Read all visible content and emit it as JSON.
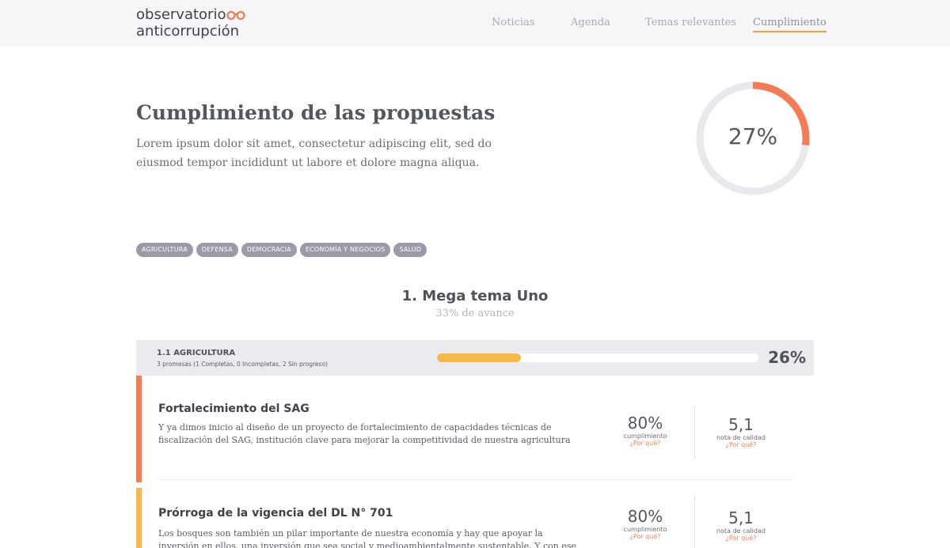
{
  "header": {
    "logo_line1": "observatorio",
    "logo_line2": "anticorrupción",
    "nav": [
      {
        "label": "Noticias",
        "active": false
      },
      {
        "label": "Agenda",
        "active": false
      },
      {
        "label": "Temas relevantes",
        "active": false
      },
      {
        "label": "Cumplimiento",
        "active": true
      }
    ]
  },
  "hero": {
    "title": "Cumplimiento de las propuestas",
    "description": "Lorem ipsum dolor sit amet, consectetur adipiscing elit, sed do eiusmod tempor incididunt ut labore et dolore magna aliqua.",
    "progress_percent": 27,
    "progress_label": "27%"
  },
  "tags": [
    "Agricultura",
    "Defensa",
    "Democracia",
    "Economía y Negocios",
    "Salud"
  ],
  "mega": {
    "title": "1. Mega tema Uno",
    "subtitle": "33% de avance"
  },
  "category": {
    "title": "1.1 AGRICULTURA",
    "subtitle": "3 promesas (1 Completas, 0 Incompletas, 2 Sin progreso)",
    "progress_percent": 26,
    "progress_label": "26%"
  },
  "items": [
    {
      "title": "Fortalecimiento del SAG",
      "description": "Y ya dimos inicio al diseño de un proyecto de fortalecimiento de capacidades técnicas de fiscalización del SAG, institución clave para mejorar la competitividad de nuestra agricultura",
      "accent_color": "#f47c55",
      "cumplimiento": "80%",
      "cumplimiento_label": "cumplimiento",
      "calidad": "5,1",
      "calidad_label": "nota de calidad",
      "why_label": "¿Por qué?"
    },
    {
      "title": "Prórroga de la vigencia del DL N° 701",
      "description": "Los bosques son también un pilar importante de nuestra economía y hay que apoyar la inversión en ellos, una inversión que sea social y medioambientalmente sustentable. Y con ese fin, entre otras",
      "accent_color": "#f7b84a",
      "cumplimiento": "80%",
      "cumplimiento_label": "cumplimiento",
      "calidad": "5,1",
      "calidad_label": "nota de calidad",
      "why_label": "¿Por qué?"
    }
  ],
  "colors": {
    "accent_orange": "#f47c55",
    "accent_yellow": "#f7b84a",
    "nav_underline": "#f4a13c",
    "tag_bg": "#9a9ba6",
    "donut_track": "#e8e9ed"
  }
}
